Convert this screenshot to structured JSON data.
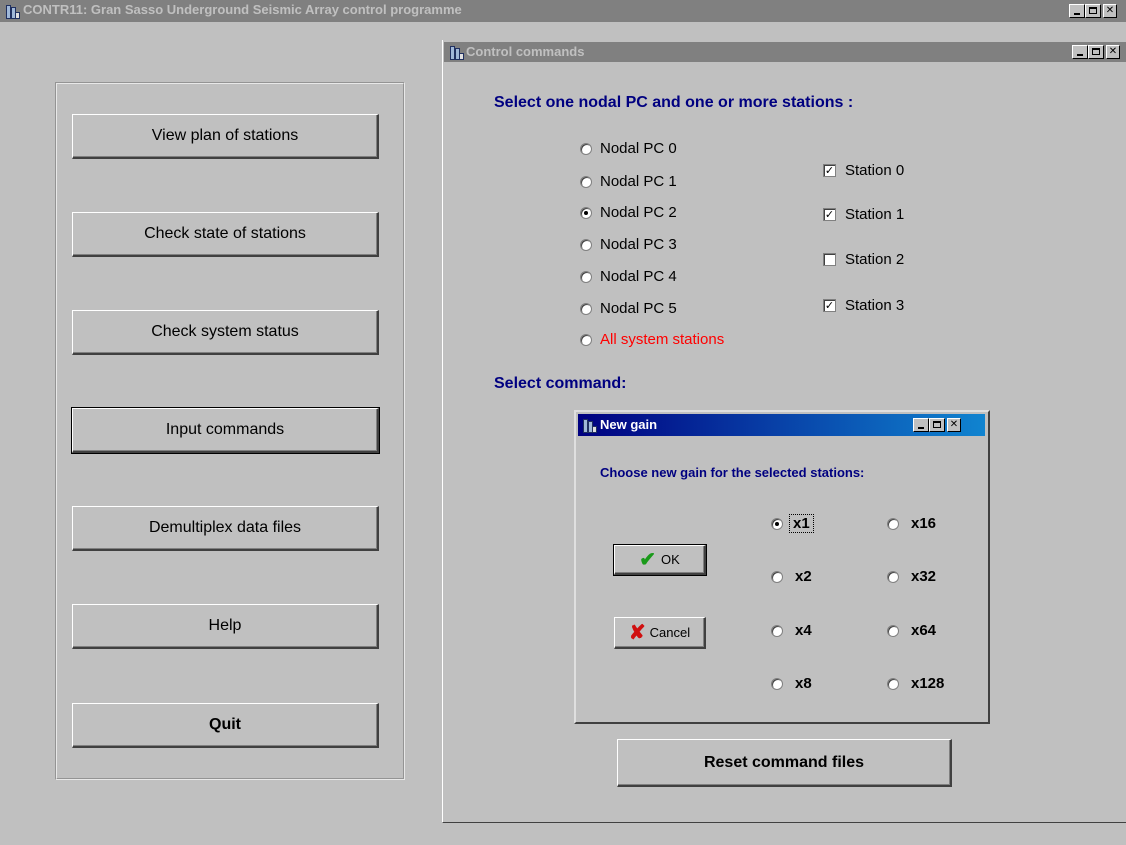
{
  "app_window": {
    "title": "CONTR11: Gran Sasso Underground Seismic Array control programme"
  },
  "main_menu": {
    "buttons": [
      {
        "label": "View plan of stations"
      },
      {
        "label": "Check state of stations"
      },
      {
        "label": "Check system status"
      },
      {
        "label": "Input commands"
      },
      {
        "label": "Demultiplex data files"
      },
      {
        "label": "Help"
      },
      {
        "label": "Quit"
      }
    ]
  },
  "control_window": {
    "title": "Control commands",
    "select_heading": "Select one nodal PC and one or more stations :",
    "nodal_pcs": [
      {
        "label": "Nodal PC 0",
        "selected": false
      },
      {
        "label": "Nodal PC 1",
        "selected": false
      },
      {
        "label": "Nodal PC 2",
        "selected": true
      },
      {
        "label": "Nodal PC 3",
        "selected": false
      },
      {
        "label": "Nodal PC 4",
        "selected": false
      },
      {
        "label": "Nodal PC 5",
        "selected": false
      },
      {
        "label": "All system stations",
        "selected": false,
        "color": "#ff0000"
      }
    ],
    "stations": [
      {
        "label": "Station 0",
        "checked": true
      },
      {
        "label": "Station 1",
        "checked": true
      },
      {
        "label": "Station 2",
        "checked": false
      },
      {
        "label": "Station 3",
        "checked": true
      }
    ],
    "command_heading": "Select command:",
    "reset_label": "Reset command files"
  },
  "gain_dialog": {
    "title": "New gain",
    "prompt": "Choose new gain for the selected stations:",
    "ok_label": "OK",
    "cancel_label": "Cancel",
    "gains": [
      {
        "label": "x1",
        "selected": true
      },
      {
        "label": "x2",
        "selected": false
      },
      {
        "label": "x4",
        "selected": false
      },
      {
        "label": "x8",
        "selected": false
      },
      {
        "label": "x16",
        "selected": false
      },
      {
        "label": "x32",
        "selected": false
      },
      {
        "label": "x64",
        "selected": false
      },
      {
        "label": "x128",
        "selected": false
      }
    ]
  },
  "colors": {
    "face": "#c0c0c0",
    "active_title": "#000080",
    "inactive_title": "#808080",
    "heading_text": "#000080",
    "all_stations_text": "#ff0000"
  }
}
